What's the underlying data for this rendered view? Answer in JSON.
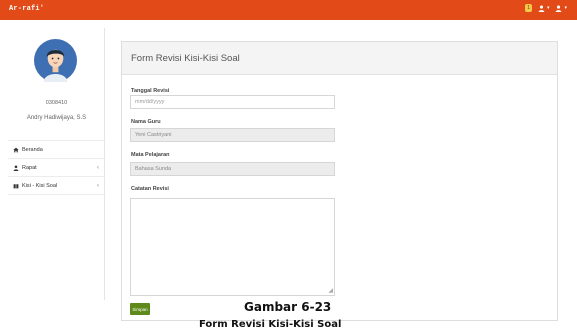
{
  "app": {
    "brand": "Ar-rafi'"
  },
  "topbar": {
    "notif_count": "1",
    "user_icon": "user-icon",
    "caret": "▾"
  },
  "sidebar": {
    "user_id": "0308410",
    "user_name": "Andry Hadiwijaya, S.S",
    "items": [
      {
        "label": "Beranda",
        "icon": "home-icon",
        "has_chevron": false
      },
      {
        "label": "Rapat",
        "icon": "user-icon",
        "has_chevron": true
      },
      {
        "label": "Kisi - Kisi Soal",
        "icon": "book-icon",
        "has_chevron": true
      }
    ]
  },
  "form": {
    "title": "Form Revisi Kisi-Kisi Soal",
    "tanggal_label": "Tanggal Revisi",
    "tanggal_placeholder": "mm/dd/yyyy",
    "guru_label": "Nama Guru",
    "guru_value": "Yeni Castriyani",
    "mapel_label": "Mata Pelajaran",
    "mapel_value": "Bahasa Sunda",
    "catatan_label": "Catatan Revisi",
    "catatan_value": "",
    "submit_label": "Simpan"
  },
  "caption": {
    "figure": "Gambar 6-23",
    "subtitle": "Form Revisi Kisi-Kisi Soal"
  },
  "colors": {
    "accent": "#e24a17",
    "button": "#5e8a1c"
  }
}
